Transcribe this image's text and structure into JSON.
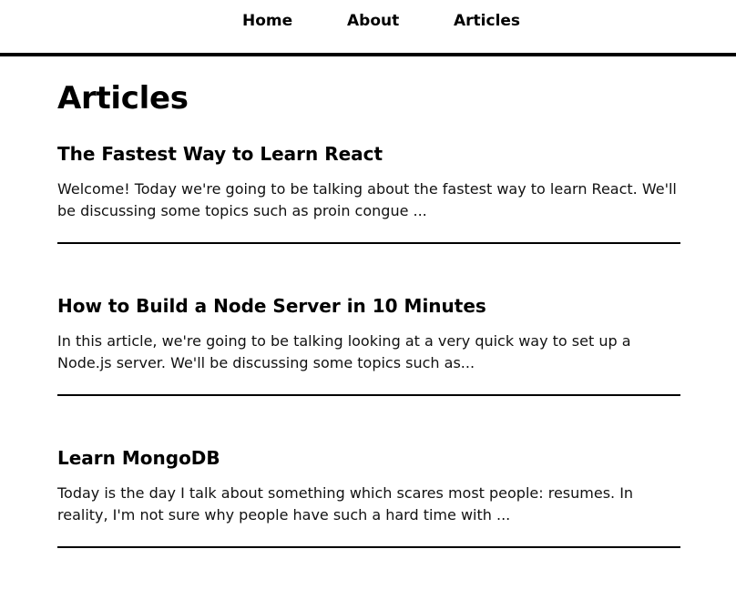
{
  "nav": {
    "items": [
      {
        "label": "Home"
      },
      {
        "label": "About"
      },
      {
        "label": "Articles"
      }
    ]
  },
  "main": {
    "title": "Articles",
    "articles": [
      {
        "title": "The Fastest Way to Learn React",
        "excerpt": "Welcome! Today we're going to be talking about the fastest way to learn React. We'll be discussing some topics such as proin congue ..."
      },
      {
        "title": "How to Build a Node Server in 10 Minutes",
        "excerpt": "In this article, we're going to be talking looking at a very quick way to set up a Node.js server. We'll be discussing some topics such as..."
      },
      {
        "title": "Learn MongoDB",
        "excerpt": "Today is the day I talk about something which scares most people: resumes. In reality, I'm not sure why people have such a hard time with ..."
      }
    ]
  }
}
